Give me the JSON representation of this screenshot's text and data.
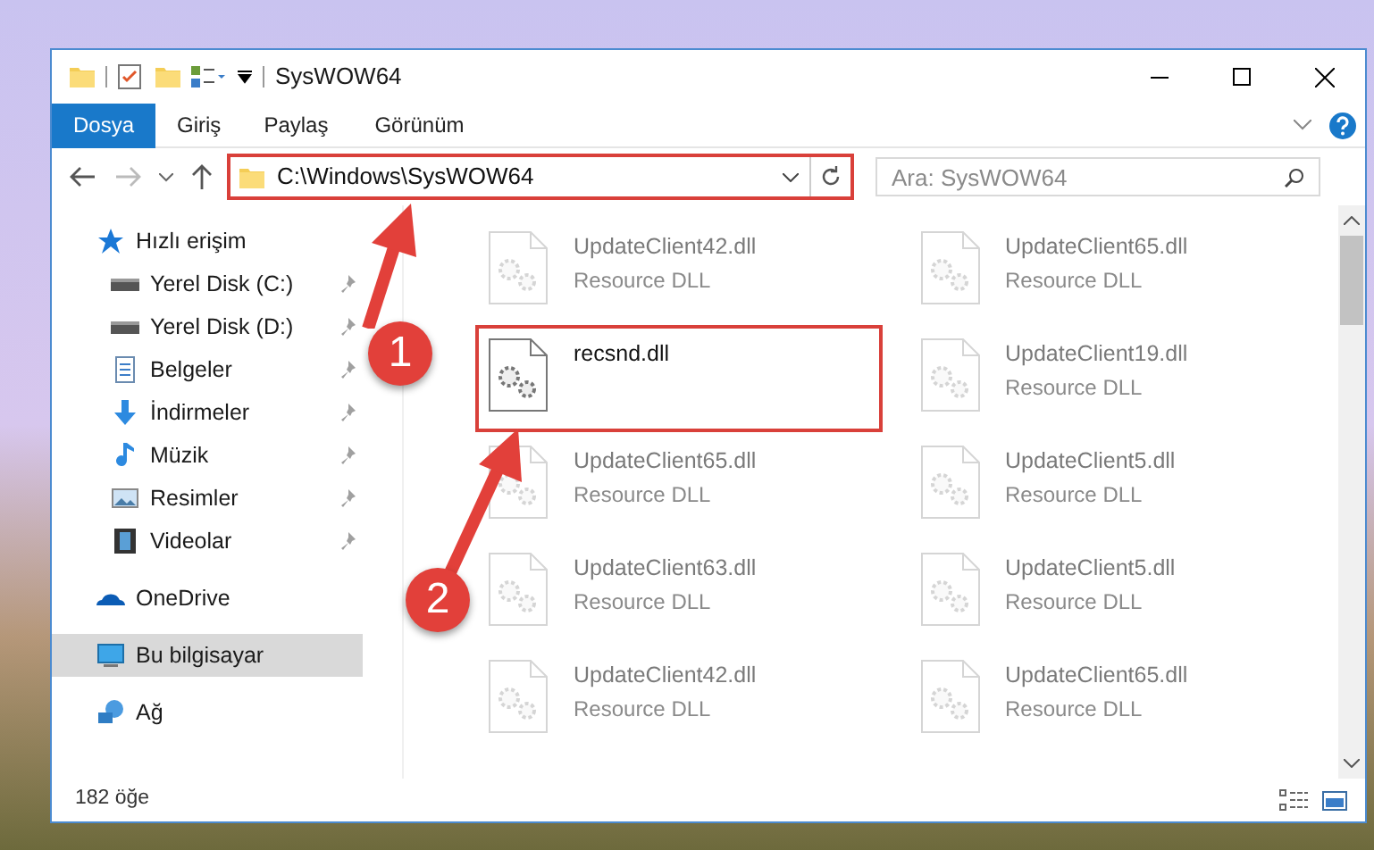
{
  "window": {
    "title": "SysWOW64"
  },
  "ribbon_tabs": [
    {
      "label": "Dosya",
      "selected": true
    },
    {
      "label": "Giriş",
      "selected": false
    },
    {
      "label": "Paylaş",
      "selected": false
    },
    {
      "label": "Görünüm",
      "selected": false
    }
  ],
  "address_bar": {
    "path": "C:\\Windows\\SysWOW64"
  },
  "search": {
    "placeholder": "Ara: SysWOW64"
  },
  "nav_pane": [
    {
      "label": "Hızlı erişim",
      "kind": "quick",
      "pinned": false,
      "selected": false,
      "children": [
        {
          "label": "Yerel Disk (C:)",
          "kind": "drive",
          "pinned": true,
          "selected": false
        },
        {
          "label": "Yerel Disk (D:)",
          "kind": "drive",
          "pinned": true,
          "selected": false
        },
        {
          "label": "Belgeler",
          "kind": "docs",
          "pinned": true,
          "selected": false
        },
        {
          "label": "İndirmeler",
          "kind": "downloads",
          "pinned": true,
          "selected": false
        },
        {
          "label": "Müzik",
          "kind": "music",
          "pinned": true,
          "selected": false
        },
        {
          "label": "Resimler",
          "kind": "pictures",
          "pinned": true,
          "selected": false
        },
        {
          "label": "Videolar",
          "kind": "videos",
          "pinned": true,
          "selected": false
        }
      ]
    },
    {
      "label": "OneDrive",
      "kind": "cloud",
      "pinned": false,
      "selected": false
    },
    {
      "label": "Bu bilgisayar",
      "kind": "pc",
      "pinned": false,
      "selected": true
    },
    {
      "label": "Ağ",
      "kind": "network",
      "pinned": false,
      "selected": false
    }
  ],
  "files": [
    {
      "name": "UpdateClient42.dll",
      "type": "Resource DLL",
      "highlighted": false
    },
    {
      "name": "UpdateClient65.dll",
      "type": "Resource DLL",
      "highlighted": false
    },
    {
      "name": "recsnd.dll",
      "highlighted": true
    },
    {
      "name": "UpdateClient19.dll",
      "type": "Resource DLL",
      "highlighted": false
    },
    {
      "name": "UpdateClient65.dll",
      "type": "Resource DLL",
      "highlighted": false
    },
    {
      "name": "UpdateClient5.dll",
      "type": "Resource DLL",
      "highlighted": false
    },
    {
      "name": "UpdateClient63.dll",
      "type": "Resource DLL",
      "highlighted": false
    },
    {
      "name": "UpdateClient5.dll",
      "type": "Resource DLL",
      "highlighted": false
    },
    {
      "name": "UpdateClient42.dll",
      "type": "Resource DLL",
      "highlighted": false
    },
    {
      "name": "UpdateClient65.dll",
      "type": "Resource DLL",
      "highlighted": false
    }
  ],
  "status_bar": {
    "count": "182 öğe"
  },
  "annotations": [
    {
      "number": "1"
    },
    {
      "number": "2"
    }
  ]
}
